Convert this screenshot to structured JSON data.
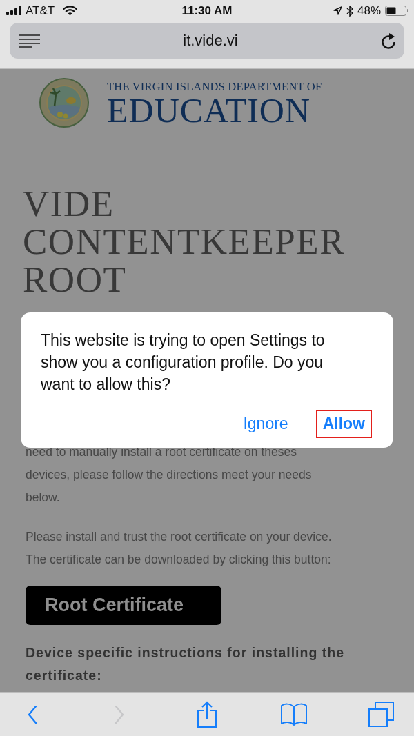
{
  "status_bar": {
    "carrier": "AT&T",
    "time": "11:30 AM",
    "battery": "48%"
  },
  "address_bar": {
    "url": "it.vide.vi"
  },
  "page": {
    "logo": {
      "line_1": "THE VIRGIN ISLANDS DEPARTMENT OF",
      "line_2": "EDUCATION"
    },
    "heading": "VIDE CONTENTKEEPER ROOT",
    "paragraphs": [
      {
        "lines": [
          "need to manually install a root certificate on theses",
          "devices, please follow the directions meet your needs",
          "below."
        ]
      },
      {
        "lines": [
          "Please install and trust the root certificate on your device.",
          "The certificate can be downloaded by clicking this button:"
        ]
      }
    ],
    "download_button": "Root Certificate",
    "subheading": "Device specific instructions for installing the certificate:"
  },
  "dialog": {
    "message": "This website is trying to open Settings to show you a configuration profile. Do you want to allow this?",
    "actions": [
      {
        "label": "Ignore",
        "primary": false,
        "highlighted": false
      },
      {
        "label": "Allow",
        "primary": true,
        "highlighted": true
      }
    ]
  },
  "toolbar": {
    "items": [
      {
        "kind": "back",
        "disabled": false
      },
      {
        "kind": "forward",
        "disabled": true
      },
      {
        "kind": "share",
        "disabled": false
      },
      {
        "kind": "bookmarks",
        "disabled": false
      },
      {
        "kind": "tabs",
        "disabled": false
      }
    ]
  }
}
